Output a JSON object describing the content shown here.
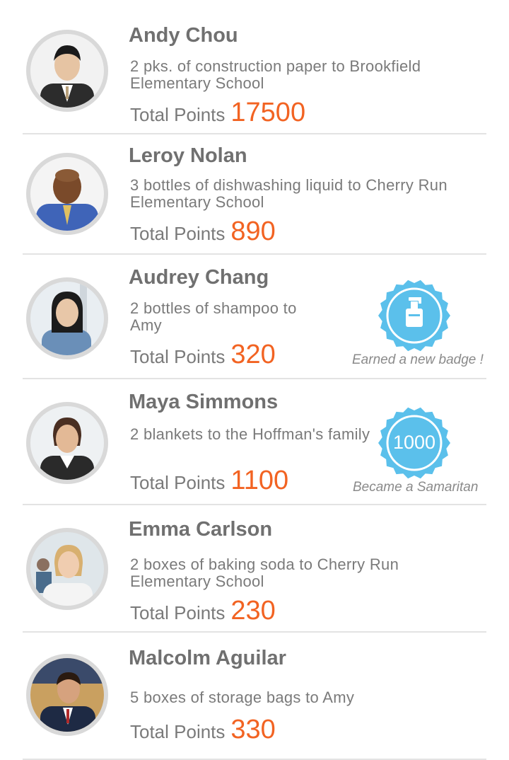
{
  "feed": [
    {
      "name": "Andy Chou",
      "description": "2 pks. of construction paper to Brookfield Elementary School",
      "points_label": "Total Points",
      "points": "17500"
    },
    {
      "name": "Leroy Nolan",
      "description": "3 bottles of dishwashing liquid to Cherry Run Elementary School",
      "points_label": "Total Points",
      "points": "890"
    },
    {
      "name": "Audrey Chang",
      "description": "2 bottles of shampoo to Amy",
      "points_label": "Total Points",
      "points": "320",
      "badge_icon": "soap-bottle-icon",
      "badge_caption": "Earned a new badge !"
    },
    {
      "name": "Maya Simmons",
      "description": "2 blankets to the Hoffman's family",
      "points_label": "Total Points",
      "points": "1100",
      "badge_text": "1000",
      "badge_caption": "Became a Samaritan"
    },
    {
      "name": "Emma Carlson",
      "description": "2 boxes of baking soda to Cherry Run Elementary School",
      "points_label": "Total Points",
      "points": "230"
    },
    {
      "name": "Malcolm Aguilar",
      "description": "5 boxes of storage bags to Amy",
      "points_label": "Total Points",
      "points": "330"
    }
  ],
  "colors": {
    "accent": "#f26322",
    "badge": "#5bc0eb",
    "text": "#707070",
    "divider": "#e3e3e3"
  }
}
